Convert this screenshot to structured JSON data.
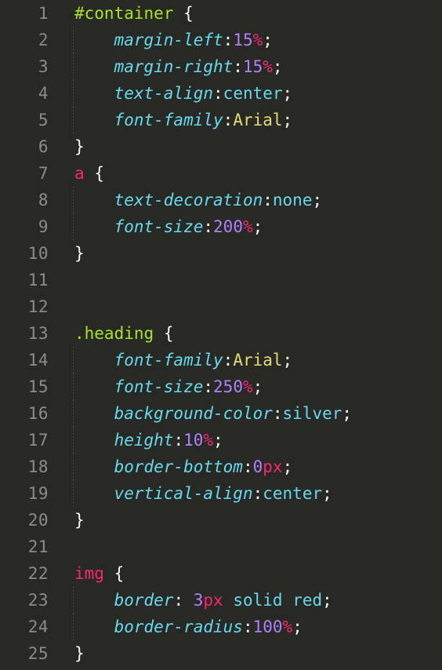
{
  "editor": {
    "language": "css",
    "theme": "monokai-dark",
    "background_color": "#282924",
    "gutter_color": "#8c8d86",
    "indent_guide_color": "#4a4b45",
    "total_lines": 25,
    "colors": {
      "selector_id": "#a6e22e",
      "selector_class": "#a6e22e",
      "selector_tag": "#f92672",
      "property": "#66d9ef",
      "value_keyword": "#66d9ef",
      "value_string": "#e6db74",
      "number": "#ae81ff",
      "unit": "#f92672",
      "punctuation": "#f8f8f2",
      "brace": "#f8f8f2"
    }
  },
  "lines": [
    {
      "num": "1",
      "guide": false,
      "tokens": [
        {
          "t": "#container",
          "c": "tok-selector-id"
        },
        {
          "t": " ",
          "c": "tok-punct"
        },
        {
          "t": "{",
          "c": "tok-brace"
        }
      ]
    },
    {
      "num": "2",
      "guide": true,
      "tokens": [
        {
          "t": "    ",
          "c": "tok-punct"
        },
        {
          "t": "margin-left",
          "c": "tok-prop"
        },
        {
          "t": ":",
          "c": "tok-punct"
        },
        {
          "t": "15",
          "c": "tok-number"
        },
        {
          "t": "%",
          "c": "tok-unit"
        },
        {
          "t": ";",
          "c": "tok-punct"
        }
      ]
    },
    {
      "num": "3",
      "guide": true,
      "tokens": [
        {
          "t": "    ",
          "c": "tok-punct"
        },
        {
          "t": "margin-right",
          "c": "tok-prop"
        },
        {
          "t": ":",
          "c": "tok-punct"
        },
        {
          "t": "15",
          "c": "tok-number"
        },
        {
          "t": "%",
          "c": "tok-unit"
        },
        {
          "t": ";",
          "c": "tok-punct"
        }
      ]
    },
    {
      "num": "4",
      "guide": true,
      "tokens": [
        {
          "t": "    ",
          "c": "tok-punct"
        },
        {
          "t": "text-align",
          "c": "tok-prop"
        },
        {
          "t": ":",
          "c": "tok-punct"
        },
        {
          "t": "center",
          "c": "tok-value"
        },
        {
          "t": ";",
          "c": "tok-punct"
        }
      ]
    },
    {
      "num": "5",
      "guide": true,
      "tokens": [
        {
          "t": "    ",
          "c": "tok-punct"
        },
        {
          "t": "font-family",
          "c": "tok-prop"
        },
        {
          "t": ":",
          "c": "tok-punct"
        },
        {
          "t": "Arial",
          "c": "tok-string"
        },
        {
          "t": ";",
          "c": "tok-punct"
        }
      ]
    },
    {
      "num": "6",
      "guide": false,
      "tokens": [
        {
          "t": "}",
          "c": "tok-brace"
        }
      ]
    },
    {
      "num": "7",
      "guide": false,
      "tokens": [
        {
          "t": "a",
          "c": "tok-selector-tag"
        },
        {
          "t": " ",
          "c": "tok-punct"
        },
        {
          "t": "{",
          "c": "tok-brace"
        }
      ]
    },
    {
      "num": "8",
      "guide": true,
      "tokens": [
        {
          "t": "    ",
          "c": "tok-punct"
        },
        {
          "t": "text-decoration",
          "c": "tok-prop"
        },
        {
          "t": ":",
          "c": "tok-punct"
        },
        {
          "t": "none",
          "c": "tok-value"
        },
        {
          "t": ";",
          "c": "tok-punct"
        }
      ]
    },
    {
      "num": "9",
      "guide": true,
      "tokens": [
        {
          "t": "    ",
          "c": "tok-punct"
        },
        {
          "t": "font-size",
          "c": "tok-prop"
        },
        {
          "t": ":",
          "c": "tok-punct"
        },
        {
          "t": "200",
          "c": "tok-number"
        },
        {
          "t": "%",
          "c": "tok-unit"
        },
        {
          "t": ";",
          "c": "tok-punct"
        }
      ]
    },
    {
      "num": "10",
      "guide": false,
      "tokens": [
        {
          "t": "}",
          "c": "tok-brace"
        }
      ]
    },
    {
      "num": "11",
      "guide": false,
      "tokens": []
    },
    {
      "num": "12",
      "guide": false,
      "tokens": []
    },
    {
      "num": "13",
      "guide": false,
      "tokens": [
        {
          "t": ".heading",
          "c": "tok-selector-class"
        },
        {
          "t": " ",
          "c": "tok-punct"
        },
        {
          "t": "{",
          "c": "tok-brace"
        }
      ]
    },
    {
      "num": "14",
      "guide": true,
      "tokens": [
        {
          "t": "    ",
          "c": "tok-punct"
        },
        {
          "t": "font-family",
          "c": "tok-prop"
        },
        {
          "t": ":",
          "c": "tok-punct"
        },
        {
          "t": "Arial",
          "c": "tok-string"
        },
        {
          "t": ";",
          "c": "tok-punct"
        }
      ]
    },
    {
      "num": "15",
      "guide": true,
      "tokens": [
        {
          "t": "    ",
          "c": "tok-punct"
        },
        {
          "t": "font-size",
          "c": "tok-prop"
        },
        {
          "t": ":",
          "c": "tok-punct"
        },
        {
          "t": "250",
          "c": "tok-number"
        },
        {
          "t": "%",
          "c": "tok-unit"
        },
        {
          "t": ";",
          "c": "tok-punct"
        }
      ]
    },
    {
      "num": "16",
      "guide": true,
      "tokens": [
        {
          "t": "    ",
          "c": "tok-punct"
        },
        {
          "t": "background-color",
          "c": "tok-prop"
        },
        {
          "t": ":",
          "c": "tok-punct"
        },
        {
          "t": "silver",
          "c": "tok-value"
        },
        {
          "t": ";",
          "c": "tok-punct"
        }
      ]
    },
    {
      "num": "17",
      "guide": true,
      "tokens": [
        {
          "t": "    ",
          "c": "tok-punct"
        },
        {
          "t": "height",
          "c": "tok-prop"
        },
        {
          "t": ":",
          "c": "tok-punct"
        },
        {
          "t": "10",
          "c": "tok-number"
        },
        {
          "t": "%",
          "c": "tok-unit"
        },
        {
          "t": ";",
          "c": "tok-punct"
        }
      ]
    },
    {
      "num": "18",
      "guide": true,
      "tokens": [
        {
          "t": "    ",
          "c": "tok-punct"
        },
        {
          "t": "border-bottom",
          "c": "tok-prop"
        },
        {
          "t": ":",
          "c": "tok-punct"
        },
        {
          "t": "0",
          "c": "tok-number"
        },
        {
          "t": "px",
          "c": "tok-unit"
        },
        {
          "t": ";",
          "c": "tok-punct"
        }
      ]
    },
    {
      "num": "19",
      "guide": true,
      "tokens": [
        {
          "t": "    ",
          "c": "tok-punct"
        },
        {
          "t": "vertical-align",
          "c": "tok-prop"
        },
        {
          "t": ":",
          "c": "tok-punct"
        },
        {
          "t": "center",
          "c": "tok-value"
        },
        {
          "t": ";",
          "c": "tok-punct"
        }
      ]
    },
    {
      "num": "20",
      "guide": false,
      "tokens": [
        {
          "t": "}",
          "c": "tok-brace"
        }
      ]
    },
    {
      "num": "21",
      "guide": false,
      "tokens": []
    },
    {
      "num": "22",
      "guide": false,
      "tokens": [
        {
          "t": "img",
          "c": "tok-selector-tag"
        },
        {
          "t": " ",
          "c": "tok-punct"
        },
        {
          "t": "{",
          "c": "tok-brace"
        }
      ]
    },
    {
      "num": "23",
      "guide": true,
      "tokens": [
        {
          "t": "    ",
          "c": "tok-punct"
        },
        {
          "t": "border",
          "c": "tok-prop"
        },
        {
          "t": ": ",
          "c": "tok-punct"
        },
        {
          "t": "3",
          "c": "tok-number"
        },
        {
          "t": "px",
          "c": "tok-unit"
        },
        {
          "t": " ",
          "c": "tok-punct"
        },
        {
          "t": "solid red",
          "c": "tok-value"
        },
        {
          "t": ";",
          "c": "tok-punct"
        }
      ]
    },
    {
      "num": "24",
      "guide": true,
      "tokens": [
        {
          "t": "    ",
          "c": "tok-punct"
        },
        {
          "t": "border-radius",
          "c": "tok-prop"
        },
        {
          "t": ":",
          "c": "tok-punct"
        },
        {
          "t": "100",
          "c": "tok-number"
        },
        {
          "t": "%",
          "c": "tok-unit"
        },
        {
          "t": ";",
          "c": "tok-punct"
        }
      ]
    },
    {
      "num": "25",
      "guide": false,
      "tokens": [
        {
          "t": "}",
          "c": "tok-brace"
        }
      ]
    }
  ]
}
